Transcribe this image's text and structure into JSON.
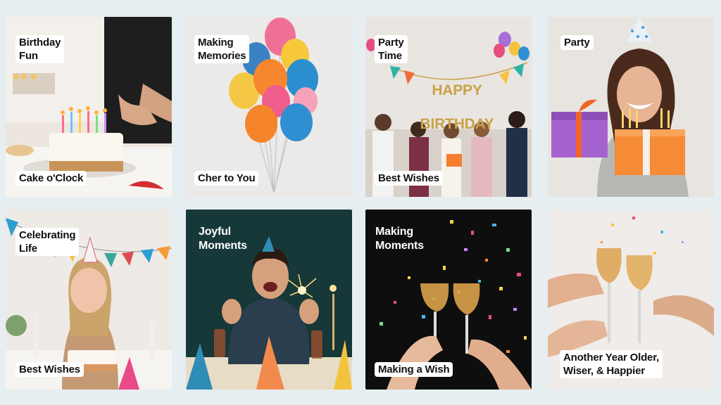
{
  "tiles": [
    {
      "top_caption": "Birthday\nFun",
      "bottom_caption": "Cake o'Clock"
    },
    {
      "top_caption": "Making\nMemories",
      "bottom_caption": "Cher to You"
    },
    {
      "top_caption": "Party\nTime",
      "bottom_caption": "Best Wishes",
      "banner_line1": "HAPPY",
      "banner_line2": "BIRTHDAY"
    },
    {
      "top_caption": "Party",
      "bottom_caption": ""
    },
    {
      "top_caption": "Celebrating\nLife",
      "bottom_caption": "Best Wishes"
    },
    {
      "top_caption": "Joyful\nMoments",
      "bottom_caption": ""
    },
    {
      "top_caption": "Making\nMoments",
      "bottom_caption": "Making a Wish"
    },
    {
      "top_caption": "",
      "bottom_caption": "Another Year Older,\nWiser, & Happier"
    }
  ]
}
